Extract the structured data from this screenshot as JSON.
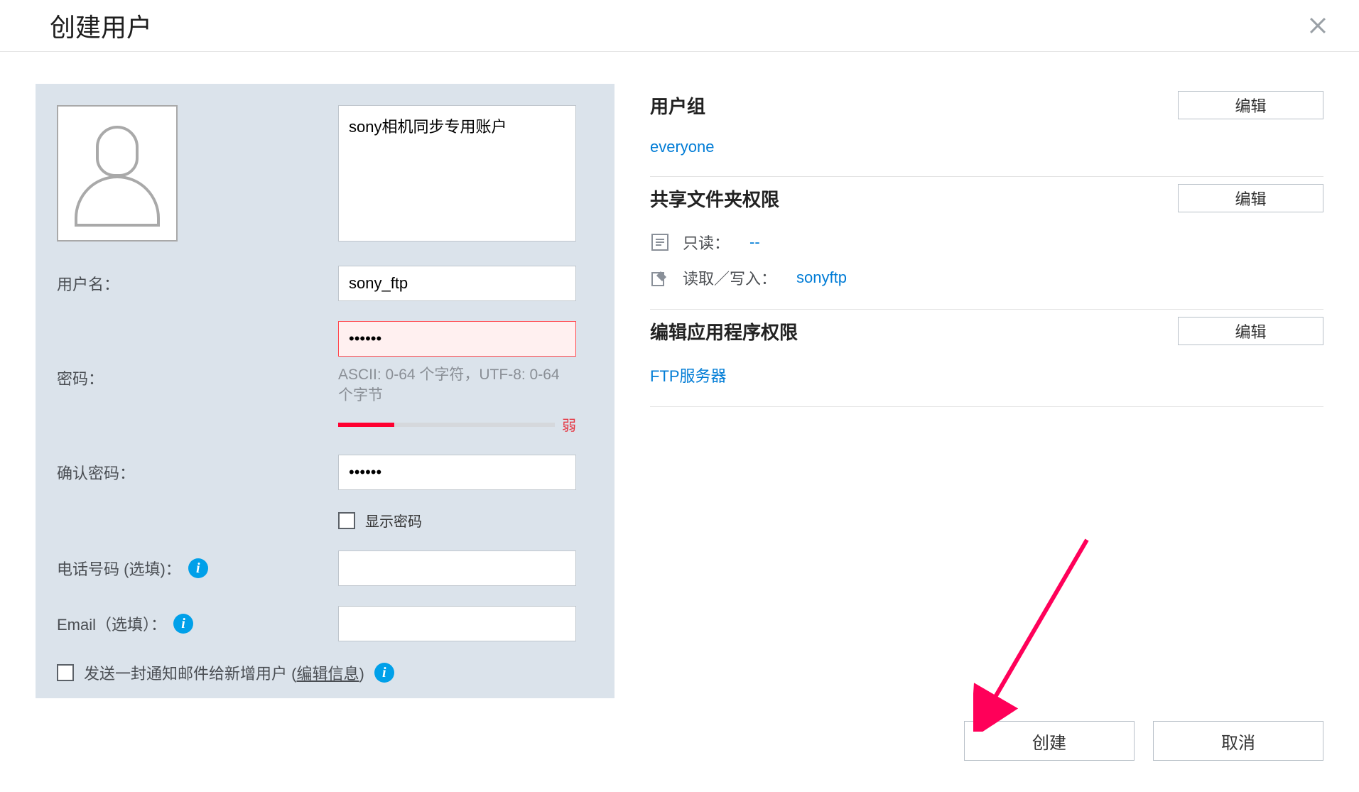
{
  "dialog": {
    "title": "创建用户",
    "description_value": "sony相机同步专用账户",
    "labels": {
      "username": "用户名：",
      "password": "密码：",
      "confirm_password": "确认密码：",
      "show_password": "显示密码",
      "phone": "电话号码 (选填)：",
      "email": "Email（选填）：",
      "notify_prefix": "发送一封通知邮件给新增用户 (",
      "notify_link": "编辑信息",
      "notify_suffix": ")"
    },
    "values": {
      "username": "sony_ftp",
      "password": "••••••",
      "confirm_password": "••••••",
      "phone": "",
      "email": ""
    },
    "password_hint": "ASCII: 0-64 个字符，UTF-8: 0-64 个字节",
    "password_strength": "弱"
  },
  "right": {
    "groups": {
      "title": "用户组",
      "edit": "编辑",
      "value": "everyone"
    },
    "shared": {
      "title": "共享文件夹权限",
      "edit": "编辑",
      "readonly_label": "只读：",
      "readonly_value": "--",
      "rw_label": "读取／写入：",
      "rw_value": "sonyftp"
    },
    "apps": {
      "title": "编辑应用程序权限",
      "edit": "编辑",
      "value": "FTP服务器"
    }
  },
  "footer": {
    "create": "创建",
    "cancel": "取消"
  }
}
